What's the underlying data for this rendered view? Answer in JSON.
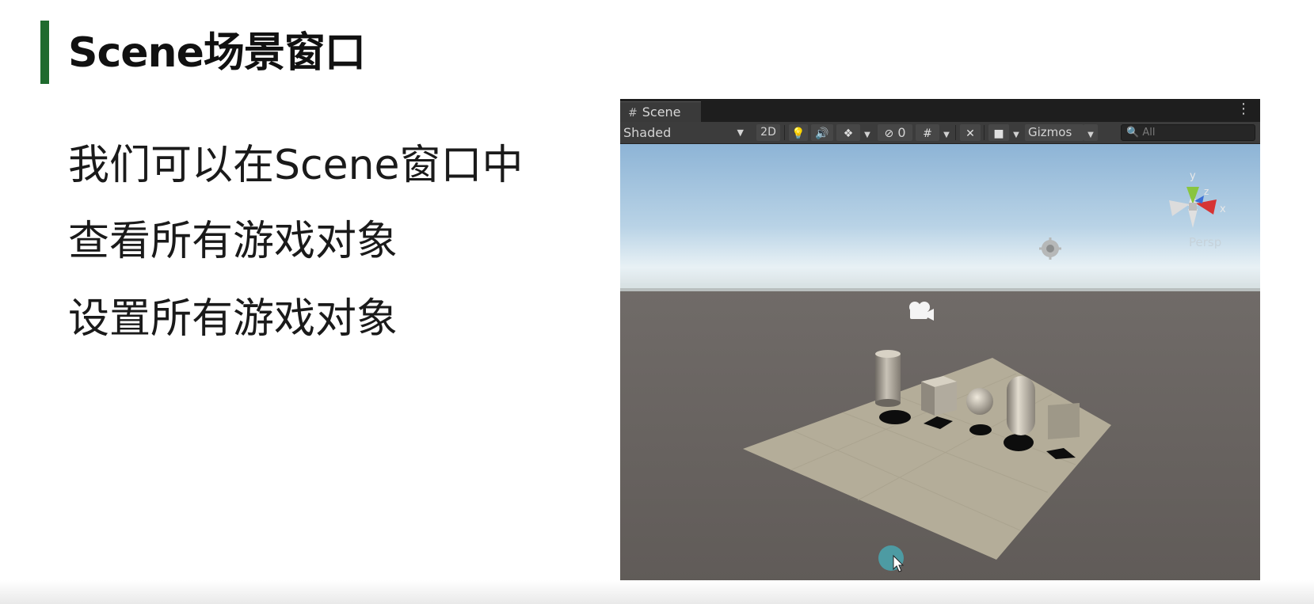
{
  "slide": {
    "title": "Scene场景窗口",
    "bullets": [
      "我们可以在Scene窗口中",
      "查看所有游戏对象",
      "设置所有游戏对象"
    ],
    "accent_color": "#1f6b2e"
  },
  "scene_window": {
    "tab_label": "Scene",
    "tab_icon": "grid-icon",
    "menu_icon": "kebab-menu-icon",
    "toolbar": {
      "draw_mode": "Shaded",
      "toggle_2d": "2D",
      "hidden_count": "0",
      "gizmos_label": "Gizmos",
      "search_placeholder": "All",
      "icons": [
        "lighting-icon",
        "audio-icon",
        "effects-icon",
        "visibility-icon",
        "grid-snap-icon",
        "tools-icon",
        "camera-icon"
      ]
    },
    "viewport": {
      "projection_label": "Persp",
      "axis_labels": {
        "y": "y",
        "x": "x",
        "z": "z"
      },
      "objects": [
        "cylinder",
        "cube",
        "sphere",
        "capsule",
        "quad",
        "plane",
        "main-camera",
        "directional-light"
      ]
    }
  }
}
